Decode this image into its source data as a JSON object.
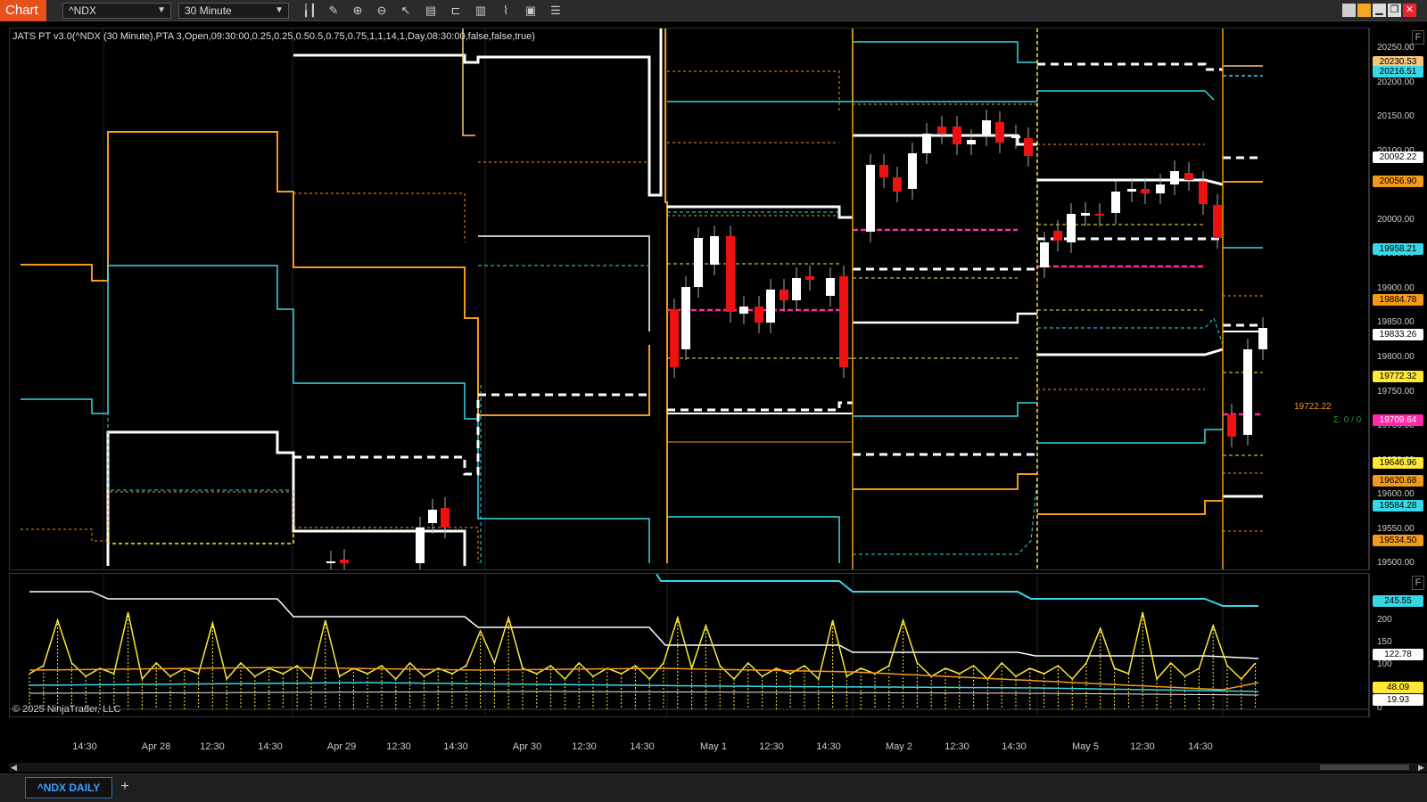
{
  "toolbar": {
    "chart_tab": "Chart",
    "instrument": "^NDX",
    "interval": "30 Minute",
    "tool_icons": [
      "bar-type-icon",
      "pencil-icon",
      "zoom-in-icon",
      "zoom-out-icon",
      "pointer-icon",
      "properties-icon",
      "template-icon",
      "indicators-icon",
      "strategy-icon",
      "data-box-icon",
      "chart-trader-icon"
    ]
  },
  "price_panel": {
    "indicator_label": "JATS PT v3.0(^NDX (30 Minute),PTA 3,Open,09:30:00,0.25,0.25,0.50.5,0.75,0.75,1,1,14,1,Day,08:30:00,false,false,true)",
    "float_label": "19722.22",
    "sigma_label": "Σ: 0 / 0",
    "y_range": [
      19490,
      20280
    ],
    "y_ticks": [
      "20250.00",
      "20200.00",
      "20150.00",
      "20100.00",
      "20050.00",
      "20000.00",
      "19950.00",
      "19900.00",
      "19850.00",
      "19800.00",
      "19750.00",
      "19700.00",
      "19650.00",
      "19600.00",
      "19550.00",
      "19500.00"
    ],
    "price_tags": [
      {
        "value": "20230.53",
        "bg": "#f6c77a",
        "fg": "#000"
      },
      {
        "value": "20216.51",
        "bg": "#37d7e6",
        "fg": "#000"
      },
      {
        "value": "20092.22",
        "bg": "#ffffff",
        "fg": "#000"
      },
      {
        "value": "20056.90",
        "bg": "#f39a1c",
        "fg": "#000"
      },
      {
        "value": "19958.21",
        "bg": "#37d7e6",
        "fg": "#000"
      },
      {
        "value": "19884.78",
        "bg": "#f39a1c",
        "fg": "#000"
      },
      {
        "value": "19833.26",
        "bg": "#ffffff",
        "fg": "#000"
      },
      {
        "value": "19772.32",
        "bg": "#ffe838",
        "fg": "#000"
      },
      {
        "value": "19709.64",
        "bg": "#ff2aa8",
        "fg": "#fff"
      },
      {
        "value": "19646.96",
        "bg": "#ffe838",
        "fg": "#000"
      },
      {
        "value": "19620.68",
        "bg": "#f39a1c",
        "fg": "#000"
      },
      {
        "value": "19584.28",
        "bg": "#37d7e6",
        "fg": "#000"
      },
      {
        "value": "19534.50",
        "bg": "#f39a1c",
        "fg": "#000"
      }
    ]
  },
  "indicator_panel": {
    "copyright": "© 2025 NinjaTrader, LLC",
    "y_range": [
      0,
      300
    ],
    "y_ticks": [
      "200",
      "150",
      "100",
      "0"
    ],
    "value_tags": [
      {
        "value": "245.55",
        "bg": "#37d7e6",
        "fg": "#000"
      },
      {
        "value": "122.78",
        "bg": "#ffffff",
        "fg": "#000"
      },
      {
        "value": "48.09",
        "bg": "#ffe838",
        "fg": "#000"
      },
      {
        "value": "19.93",
        "bg": "#ffffff",
        "fg": "#000"
      }
    ]
  },
  "time_axis": {
    "labels": [
      "14:30",
      "Apr 28",
      "12:30",
      "14:30",
      "Apr 29",
      "12:30",
      "14:30",
      "Apr 30",
      "12:30",
      "14:30",
      "May 1",
      "12:30",
      "14:30",
      "May 2",
      "12:30",
      "14:30",
      "May 5",
      "12:30",
      "14:30"
    ]
  },
  "bottom_tabs": {
    "active": "^NDX DAILY",
    "add": "+"
  },
  "colors": {
    "cyan": "#37d7e6",
    "orange": "#f39a1c",
    "yellow": "#ffe838",
    "magenta": "#ff2aa8",
    "white": "#ffffff",
    "candle_up": "#ffffff",
    "candle_down": "#ee1111",
    "accent": "#e8501c"
  }
}
